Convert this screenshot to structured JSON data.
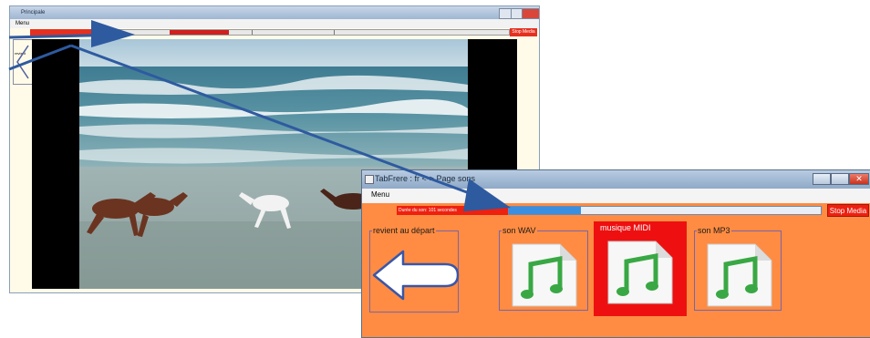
{
  "background_window": {
    "title": "Principale",
    "menu_label": "Menu",
    "revient_label": "revient",
    "stop_label": "Stop Media"
  },
  "foreground_window": {
    "title": "TabFrere : fr  <-> Page sons",
    "menu_label": "Menu",
    "duration_text": "Durée du son: 101 secondes",
    "progress_fraction": 0.23,
    "stop_label": "Stop Media",
    "close_glyph": "✕",
    "groups": [
      {
        "label": "revient au départ",
        "icon": "left-arrow-icon"
      },
      {
        "label": "son WAV",
        "icon": "music-file-icon"
      },
      {
        "label": "musique MIDI",
        "icon": "music-file-icon",
        "selected": true
      },
      {
        "label": "son MP3",
        "icon": "music-file-icon"
      }
    ]
  },
  "colors": {
    "orange_bg": "#ff8c42",
    "stop_red": "#ee2010",
    "progress_blue": "#3b8fe0",
    "annotation_arrow": "#2e5aa0"
  }
}
